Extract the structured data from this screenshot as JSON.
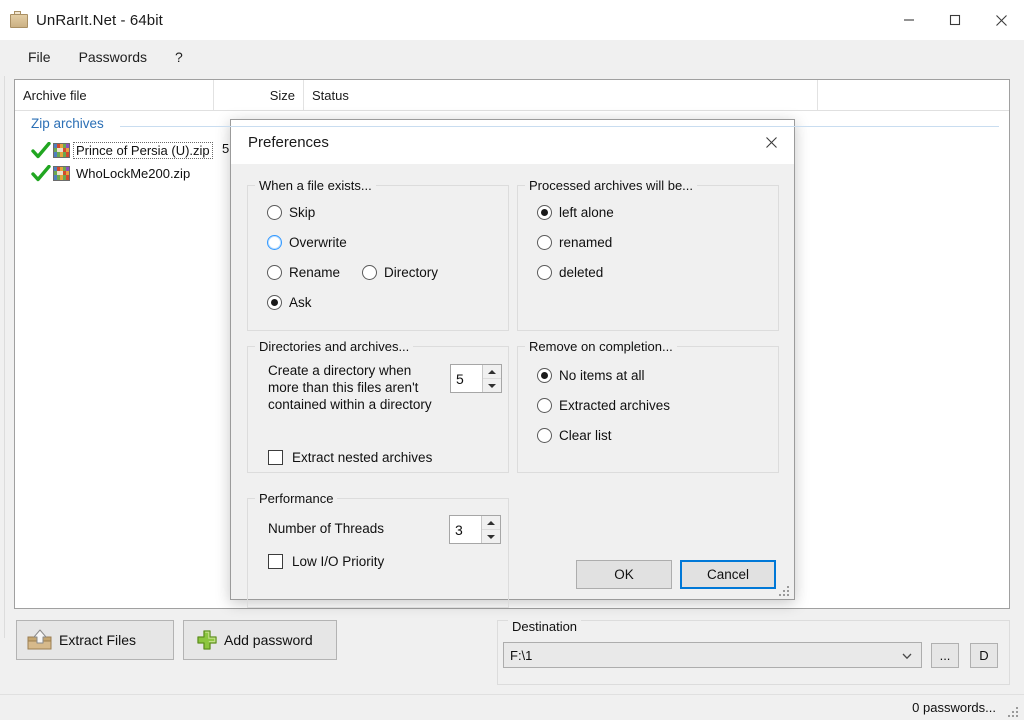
{
  "window": {
    "title": "UnRarIt.Net - 64bit",
    "icon": "archive-folder-icon",
    "minimize": "—",
    "maximize": "☐",
    "close": "✕"
  },
  "menubar": {
    "items": [
      {
        "label": "File"
      },
      {
        "label": "Passwords"
      },
      {
        "label": "?"
      }
    ]
  },
  "list": {
    "columns": [
      "Archive file",
      "Size",
      "Status",
      ""
    ],
    "group_label": "Zip archives",
    "rows": [
      {
        "name": "Prince of Persia (U).zip",
        "size": "5",
        "status": "",
        "state": "done",
        "selected": true
      },
      {
        "name": "WhoLockMe200.zip",
        "size": "",
        "status": "",
        "state": "done",
        "selected": false
      }
    ]
  },
  "toolbar": {
    "extract_label": "Extract Files",
    "extract_icon": "extract-box-icon",
    "addpw_label": "Add password",
    "addpw_icon": "green-plus-icon"
  },
  "destination": {
    "legend": "Destination",
    "value": "F:\\1",
    "placeholder": "",
    "chevron_icon": "chevron-down-icon",
    "browse_label": "...",
    "d_label": "D"
  },
  "status": {
    "text": "0 passwords..."
  },
  "dialog": {
    "title": "Preferences",
    "close_icon": "close-icon",
    "groups": {
      "file_exists": {
        "legend": "When a file exists...",
        "options": [
          {
            "label": "Skip",
            "checked": false,
            "hover": false
          },
          {
            "label": "Overwrite",
            "checked": false,
            "hover": true
          },
          {
            "label": "Rename",
            "checked": false,
            "hover": false
          },
          {
            "label": "Directory",
            "checked": false,
            "hover": false
          },
          {
            "label": "Ask",
            "checked": true,
            "hover": false
          }
        ]
      },
      "processed": {
        "legend": "Processed archives will be...",
        "options": [
          {
            "label": "left alone",
            "checked": true
          },
          {
            "label": "renamed",
            "checked": false
          },
          {
            "label": "deleted",
            "checked": false
          }
        ]
      },
      "directories": {
        "legend": "Directories and archives...",
        "field_label": "Create a directory when more than this files aren't contained within a directory",
        "field_value": "5",
        "checkbox_label": "Extract nested archives",
        "checkbox_checked": false
      },
      "remove": {
        "legend": "Remove on completion...",
        "options": [
          {
            "label": "No items at all",
            "checked": true
          },
          {
            "label": "Extracted archives",
            "checked": false
          },
          {
            "label": "Clear list",
            "checked": false
          }
        ]
      },
      "performance": {
        "legend": "Performance",
        "threads_label": "Number of Threads",
        "threads_value": "3",
        "checkbox_label": "Low I/O Priority",
        "checkbox_checked": false
      }
    },
    "ok_label": "OK",
    "cancel_label": "Cancel"
  },
  "colors": {
    "accent": "#0078d7",
    "group_header": "#2b6fb5",
    "check_green": "#2eae2e",
    "window_bg": "#f0f0f0"
  }
}
